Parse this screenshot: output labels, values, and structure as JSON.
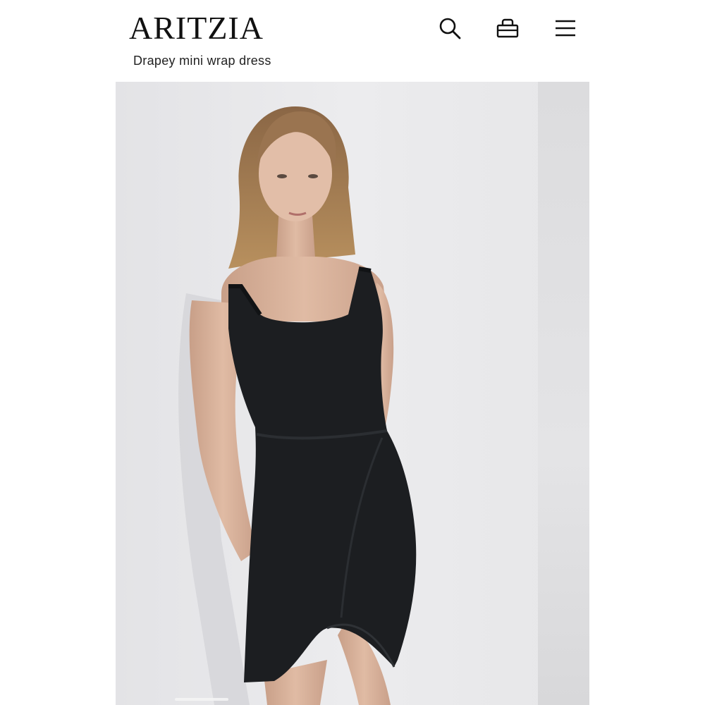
{
  "header": {
    "logo": "ARITZIA",
    "search_icon": "search-icon",
    "bag_icon": "shopping-bag-icon",
    "menu_icon": "hamburger-menu-icon"
  },
  "product": {
    "title": "Drapey mini wrap dress",
    "image_description_icon": "product-photo"
  },
  "colors": {
    "text": "#111111",
    "background": "#ffffff",
    "image_bg": "#e8e8ea",
    "dress": "#1a1c1e"
  }
}
